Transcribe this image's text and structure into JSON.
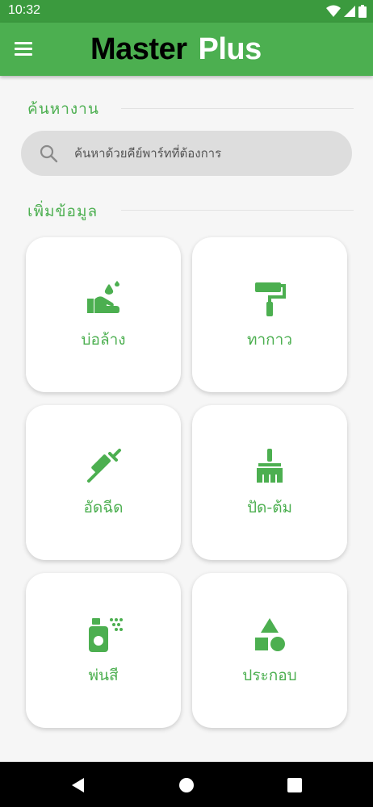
{
  "status_bar": {
    "time": "10:32",
    "icons": [
      "wifi-icon",
      "signal-icon",
      "battery-icon"
    ]
  },
  "app_bar": {
    "brand_part1": "Master",
    "brand_part2": "Plus",
    "menu_icon": "menu-icon"
  },
  "search_section": {
    "title": "ค้นหางาน",
    "placeholder": "ค้นหาด้วยคีย์พาร์ทที่ต้องการ",
    "value": ""
  },
  "add_section": {
    "title": "เพิ่มข้อมูล"
  },
  "categories": [
    {
      "label": "บ่อล้าง",
      "icon": "hand-wash-icon"
    },
    {
      "label": "ทากาว",
      "icon": "paint-roller-icon"
    },
    {
      "label": "อัดฉีด",
      "icon": "syringe-icon"
    },
    {
      "label": "ปัด-ต้ม",
      "icon": "broom-icon"
    },
    {
      "label": "พ่นสี",
      "icon": "spray-can-icon"
    },
    {
      "label": "ประกอบ",
      "icon": "shapes-icon"
    }
  ],
  "colors": {
    "primary": "#4caf50",
    "status_bar": "#3b9a3e",
    "background": "#f6f6f6"
  }
}
